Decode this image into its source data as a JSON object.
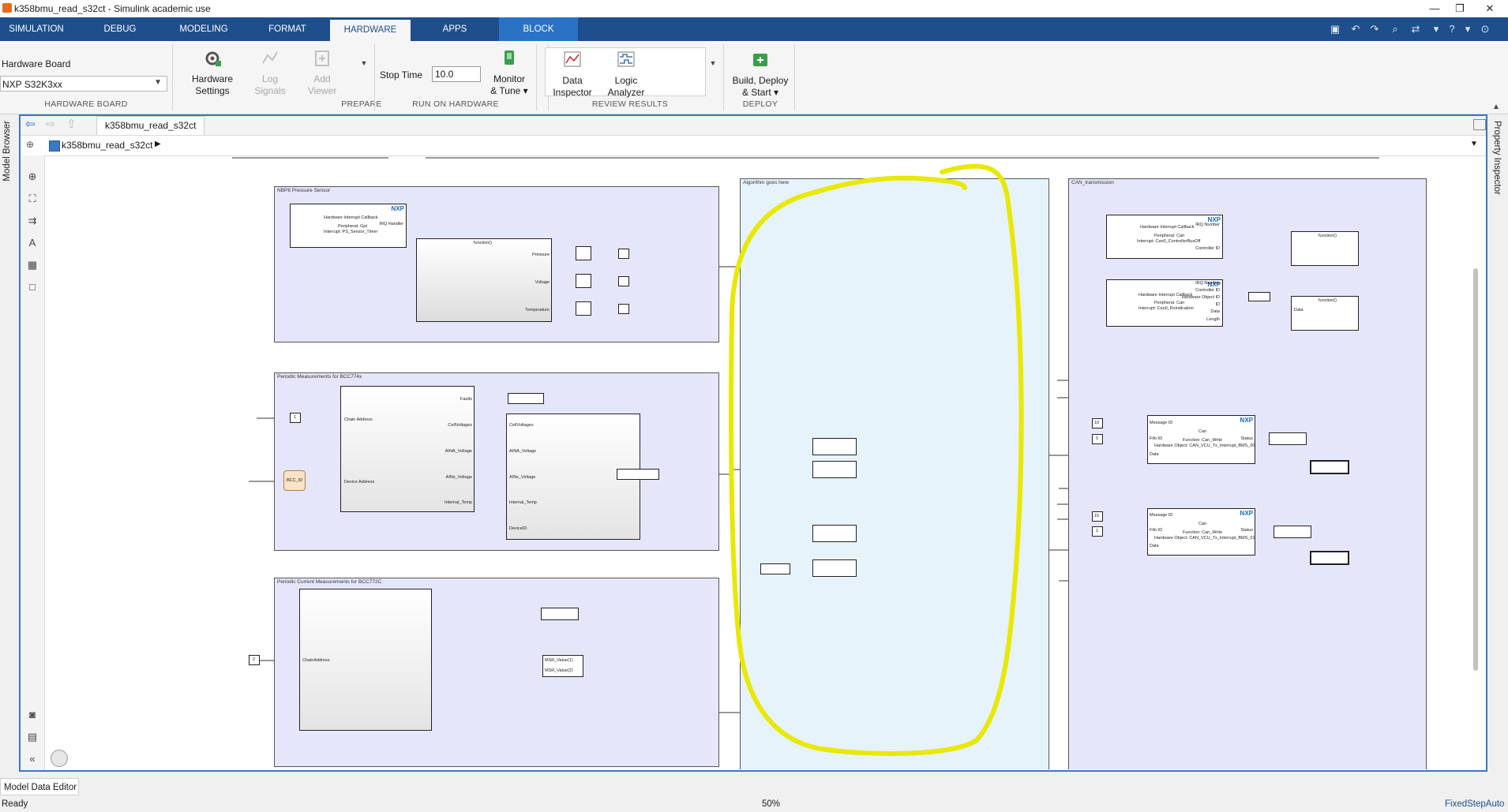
{
  "window": {
    "title": "k358bmu_read_s32ct - Simulink academic use",
    "controls": [
      "—",
      "❐",
      "✕"
    ]
  },
  "tabs": [
    {
      "label": "SIMULATION"
    },
    {
      "label": "DEBUG"
    },
    {
      "label": "MODELING"
    },
    {
      "label": "FORMAT"
    },
    {
      "label": "HARDWARE"
    },
    {
      "label": "APPS"
    },
    {
      "label": "BLOCK"
    }
  ],
  "ribbon": {
    "hardware_board": {
      "label": "Hardware Board",
      "value": "NXP S32K3xx",
      "section": "HARDWARE BOARD"
    },
    "prepare": {
      "section": "PREPARE",
      "hardware_settings": [
        "Hardware",
        "Settings"
      ],
      "log_signals": [
        "Log",
        "Signals"
      ],
      "add_viewer": [
        "Add",
        "Viewer"
      ]
    },
    "run_on_hardware": {
      "section": "RUN ON HARDWARE",
      "stop_time_label": "Stop Time",
      "stop_time_value": "10.0",
      "monitor_tune": [
        "Monitor",
        "& Tune ▾"
      ]
    },
    "review_results": {
      "section": "REVIEW RESULTS",
      "data_inspector": [
        "Data",
        "Inspector"
      ],
      "logic_analyzer": [
        "Logic",
        "Analyzer"
      ]
    },
    "deploy": {
      "section": "DEPLOY",
      "build": [
        "Build, Deploy",
        "& Start ▾"
      ]
    }
  },
  "editor": {
    "model_tab": "k358bmu_read_s32ct",
    "breadcrumb": "k358bmu_read_s32ct",
    "left_panel": "Model Browser",
    "right_panel": "Property Inspector"
  },
  "diagram": {
    "nbp8": {
      "title": "NBP8 Pressure Sensor",
      "hw_callback": [
        "Hardware Interrupt Callback",
        "Peripheral: Gpt",
        "Interrupt: PS_Sensor_Timer"
      ],
      "irq_port": "IRQ Handler",
      "fcall": "function()",
      "ports": [
        "Pressure",
        "Voltage",
        "Temperature"
      ]
    },
    "bcc774": {
      "title": "Periodic Measurements for BCC774x",
      "const": "1",
      "ports_left": [
        "Chain Address",
        "Device Address"
      ],
      "ports_right": [
        "Faults",
        "CellVoltages",
        "AINA_Voltage",
        "AINx_Voltage",
        "Internal_Temp",
        "DeviceID"
      ],
      "inner_ports": [
        "CellVoltages",
        "AINA_Voltage",
        "AINx_Voltage",
        "Internal_Temp"
      ],
      "func": "BCC_ID"
    },
    "bcc772": {
      "title": "Periodic Current Measurements for BCC772C",
      "const": "2",
      "port_left": "ChainAddress",
      "outputs": [
        "MSR_Value(1)",
        "MSR_Value(2)"
      ]
    },
    "algorithm": {
      "title": "Algorithm goes here"
    },
    "can": {
      "title": "CAN_transmission",
      "cb1": [
        "Hardware Interrupt Callback",
        "Peripheral: Can",
        "Interrupt: Can0_ControllerBusOff"
      ],
      "cb1_ports": [
        "IRQ Number",
        "Controller ID"
      ],
      "cb2": [
        "Hardware Interrupt Callback",
        "Peripheral: Can",
        "Interrupt: Can0_Rxindication"
      ],
      "cb2_ports": [
        "IRQ Number",
        "Controller ID",
        "Hardware Object ID",
        "ID",
        "Data",
        "Length"
      ],
      "fcall": "function()",
      "data_port": "Data",
      "write1": {
        "msg_id": "10",
        "fifo": "0",
        "lines": [
          "Can",
          "Function: Can_Write",
          "Hardware Object: CAN_VCU_Tx_Interrupt_BMS_00"
        ]
      },
      "write2": {
        "msg_id": "15",
        "fifo": "1",
        "lines": [
          "Can",
          "Function: Can_Write",
          "Hardware Object: CAN_VCU_Tx_Interrupt_BMS_01"
        ]
      },
      "write_ports": [
        "Message ID",
        "Fifo ID",
        "Data",
        "Status"
      ]
    },
    "nxp_logo": "NXP"
  },
  "bottom_tab": "Model Data Editor",
  "status": {
    "left": "Ready",
    "zoom": "50%",
    "solver": "FixedStepAuto"
  },
  "colors": {
    "tabstrip": "#1e4f8c",
    "block_tab": "#2a73c4",
    "subsystem_fill": "#e6e6fa",
    "algorithm_fill": "#e6f3fb",
    "highlight": "#e8e800"
  }
}
